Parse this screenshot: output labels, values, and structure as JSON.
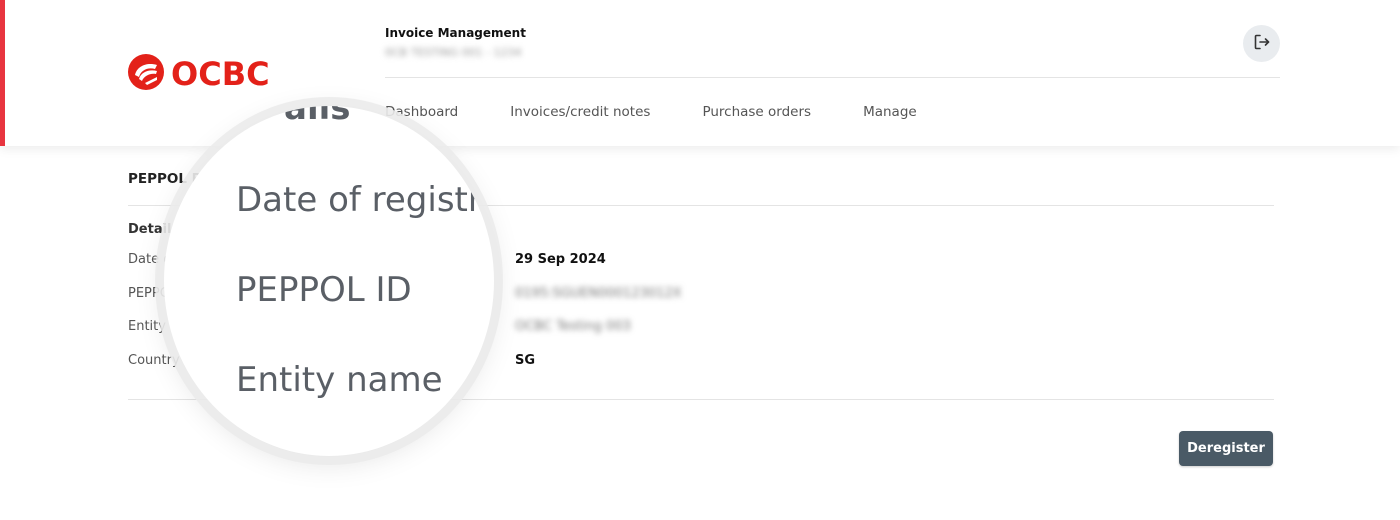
{
  "brand": {
    "logo_text": "OCBC",
    "accent_color": "#e8353f"
  },
  "header": {
    "app_title": "Invoice Management",
    "app_subtitle": "0CB TESTING 001 - 1234",
    "logout_icon": "logout-icon"
  },
  "nav": {
    "items": [
      "Dashboard",
      "Invoices/credit notes",
      "Purchase orders",
      "Manage"
    ]
  },
  "main": {
    "section_title": "PEPPOL Re",
    "details_heading": "Details",
    "rows": [
      {
        "label": "Date o",
        "value": "29 Sep 2024"
      },
      {
        "label": "PEPPC",
        "value": "0195:SGUEN000123012X"
      },
      {
        "label": "Entity n",
        "value": "OCBC Testing 003"
      },
      {
        "label": "Country c",
        "value": "SG"
      }
    ],
    "deregister_label": "Deregister"
  },
  "magnifier": {
    "partial_top": "ails",
    "lines": [
      "Date of registr",
      "PEPPOL ID",
      "Entity name"
    ]
  }
}
